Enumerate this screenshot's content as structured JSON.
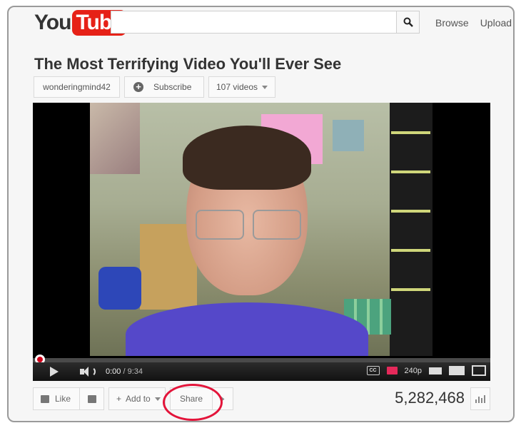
{
  "header": {
    "logo_you": "You",
    "logo_tube": "Tube",
    "search": {
      "value": "",
      "placeholder": ""
    },
    "links": [
      "Browse",
      "Upload"
    ]
  },
  "video": {
    "title": "The Most Terrifying Video You'll Ever See",
    "channel": "wonderingmind42",
    "subscribe_label": "Subscribe",
    "video_count": "107 videos"
  },
  "player": {
    "current_time": "0:00",
    "total_time": "/ 9:34",
    "quality": "240p",
    "cc_label": "CC",
    "progress": 0
  },
  "actions": {
    "like_label": "Like",
    "add_to_label": "Add to",
    "share_label": "Share",
    "views": "5,282,468"
  },
  "colors": {
    "brand_red": "#e62117",
    "highlight_ring": "#e3143a",
    "annotation_icon": "#e5295a"
  }
}
